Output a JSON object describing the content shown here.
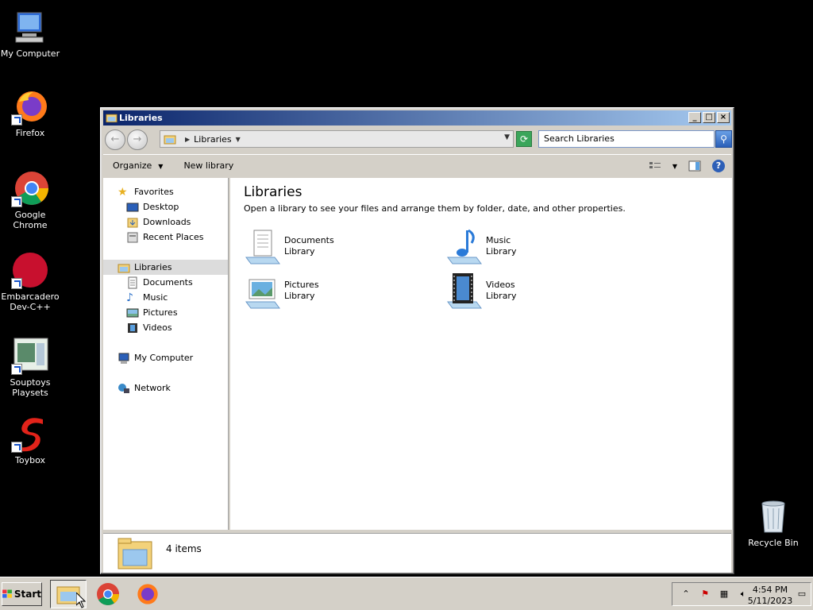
{
  "desktop": {
    "icons": [
      {
        "label": "My Computer"
      },
      {
        "label": "Firefox"
      },
      {
        "label": "Google Chrome"
      },
      {
        "label": "Embarcadero Dev-C++"
      },
      {
        "label": "Souptoys Playsets"
      },
      {
        "label": "Toybox"
      },
      {
        "label": "Recycle Bin"
      }
    ]
  },
  "window": {
    "title": "Libraries",
    "address": {
      "crumb": "Libraries"
    },
    "search": {
      "placeholder": "Search Libraries"
    },
    "commandbar": {
      "organize": "Organize",
      "new_library": "New library"
    },
    "nav": {
      "favorites": "Favorites",
      "desktop": "Desktop",
      "downloads": "Downloads",
      "recent_places": "Recent Places",
      "libraries": "Libraries",
      "documents": "Documents",
      "music": "Music",
      "pictures": "Pictures",
      "videos": "Videos",
      "my_computer": "My Computer",
      "network": "Network"
    },
    "content": {
      "title": "Libraries",
      "subtitle": "Open a library to see your files and arrange them by folder, date, and other properties.",
      "libraries": [
        {
          "name": "Documents",
          "type": "Library"
        },
        {
          "name": "Music",
          "type": "Library"
        },
        {
          "name": "Pictures",
          "type": "Library"
        },
        {
          "name": "Videos",
          "type": "Library"
        }
      ]
    },
    "details": {
      "count": "4 items"
    }
  },
  "taskbar": {
    "start": "Start",
    "clock": {
      "time": "4:54 PM",
      "date": "5/11/2023"
    }
  },
  "colors": {
    "title_start": "#0a246a",
    "title_end": "#a6caf0",
    "desktop": "#000000"
  }
}
